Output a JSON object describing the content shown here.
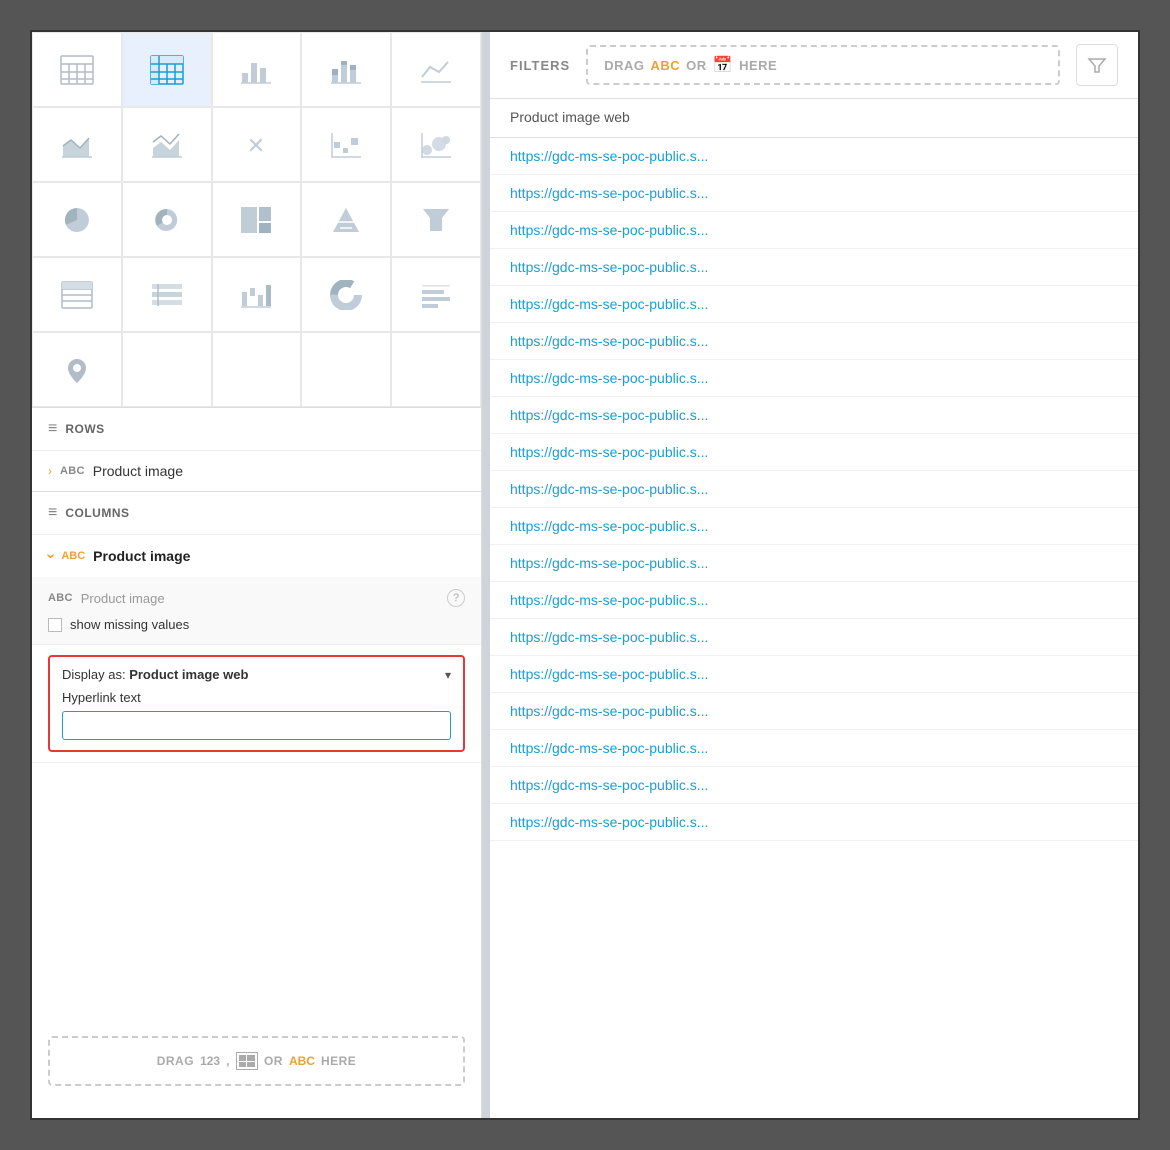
{
  "leftPanel": {
    "chartTypes": [
      {
        "id": "table",
        "label": "table-icon",
        "active": false
      },
      {
        "id": "pivot",
        "label": "pivot-icon",
        "active": true
      },
      {
        "id": "bar",
        "label": "bar-icon",
        "active": false
      },
      {
        "id": "stacked-bar",
        "label": "stacked-bar-icon",
        "active": false
      },
      {
        "id": "line",
        "label": "line-icon",
        "active": false
      },
      {
        "id": "area",
        "label": "area-icon",
        "active": false
      },
      {
        "id": "area-line",
        "label": "area-line-icon",
        "active": false
      },
      {
        "id": "cross",
        "label": "cross-icon",
        "active": false
      },
      {
        "id": "scatter",
        "label": "scatter-icon",
        "active": false
      },
      {
        "id": "bubble",
        "label": "bubble-icon",
        "active": false
      },
      {
        "id": "pie",
        "label": "pie-icon",
        "active": false
      },
      {
        "id": "donut",
        "label": "donut-icon",
        "active": false
      },
      {
        "id": "treemap",
        "label": "treemap-icon",
        "active": false
      },
      {
        "id": "pyramid",
        "label": "pyramid-icon",
        "active": false
      },
      {
        "id": "funnel",
        "label": "funnel-icon",
        "active": false
      },
      {
        "id": "data-grid",
        "label": "data-grid-icon",
        "active": false
      },
      {
        "id": "list",
        "label": "list-icon",
        "active": false
      },
      {
        "id": "waterfall",
        "label": "waterfall-icon",
        "active": false
      },
      {
        "id": "pie2",
        "label": "pie2-icon",
        "active": false
      },
      {
        "id": "xbar",
        "label": "xbar-icon",
        "active": false
      },
      {
        "id": "map",
        "label": "map-icon",
        "active": false
      }
    ],
    "rows": {
      "title": "ROWS",
      "item": {
        "abcLabel": "ABC",
        "label": "Product image"
      }
    },
    "columns": {
      "title": "COLUMNS",
      "expandedItem": {
        "abcLabel": "ABC",
        "label": "Product image"
      },
      "subPanel": {
        "abcLabel": "ABC",
        "fieldLabel": "Product image",
        "showMissingLabel": "show missing values"
      },
      "displayAs": {
        "label": "Display as:",
        "value": "Product image web",
        "hyperlinkLabel": "Hyperlink text",
        "inputPlaceholder": "",
        "inputValue": ""
      }
    },
    "bottomDrag": {
      "drag": "DRAG",
      "num": "123",
      "or": ",",
      "abc": "ABC",
      "here": "HERE"
    }
  },
  "rightPanel": {
    "filterBar": {
      "filtersLabel": "FILTERS",
      "dragLabel": "DRAG",
      "abcLabel": "ABC",
      "orLabel": "OR",
      "hereLabel": "HERE"
    },
    "columnHeader": "Product image web",
    "dataRows": [
      "https://gdc-ms-se-poc-public.s...",
      "https://gdc-ms-se-poc-public.s...",
      "https://gdc-ms-se-poc-public.s...",
      "https://gdc-ms-se-poc-public.s...",
      "https://gdc-ms-se-poc-public.s...",
      "https://gdc-ms-se-poc-public.s...",
      "https://gdc-ms-se-poc-public.s...",
      "https://gdc-ms-se-poc-public.s...",
      "https://gdc-ms-se-poc-public.s...",
      "https://gdc-ms-se-poc-public.s...",
      "https://gdc-ms-se-poc-public.s...",
      "https://gdc-ms-se-poc-public.s...",
      "https://gdc-ms-se-poc-public.s...",
      "https://gdc-ms-se-poc-public.s...",
      "https://gdc-ms-se-poc-public.s...",
      "https://gdc-ms-se-poc-public.s...",
      "https://gdc-ms-se-poc-public.s...",
      "https://gdc-ms-se-poc-public.s...",
      "https://gdc-ms-se-poc-public.s..."
    ]
  }
}
